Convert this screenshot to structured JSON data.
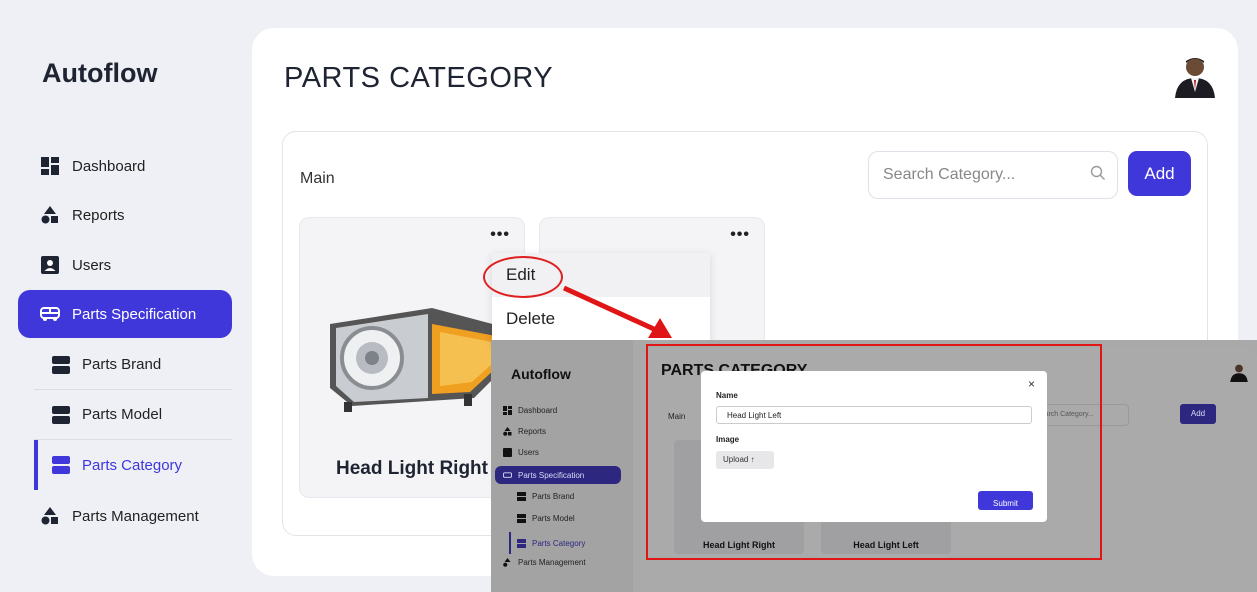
{
  "app": {
    "brand": "Autoflow",
    "page_title": "PARTS CATEGORY"
  },
  "sidebar": {
    "items": [
      {
        "label": "Dashboard",
        "icon": "dashboard-icon"
      },
      {
        "label": "Reports",
        "icon": "reports-icon"
      },
      {
        "label": "Users",
        "icon": "user-icon"
      },
      {
        "label": "Parts Specification",
        "icon": "car-icon",
        "active": true
      },
      {
        "label": "Parts Management",
        "icon": "shapes-icon"
      }
    ],
    "sub_items": [
      {
        "label": "Parts Brand",
        "icon": "layers-icon"
      },
      {
        "label": "Parts Model",
        "icon": "layers-icon"
      },
      {
        "label": "Parts Category",
        "icon": "layers-icon",
        "active": true
      }
    ]
  },
  "panel": {
    "label": "Main",
    "search_placeholder": "Search Category...",
    "add_label": "Add"
  },
  "categories": [
    {
      "name": "Head Light Right",
      "menu": "•••"
    },
    {
      "name": "",
      "menu": "•••"
    }
  ],
  "context_menu": {
    "items": [
      "Edit",
      "Delete"
    ]
  },
  "modal_shot": {
    "brand": "Autoflow",
    "title": "PARTS CATEGORY",
    "nav": [
      "Dashboard",
      "Reports",
      "Users",
      "Parts Specification",
      "Parts Brand",
      "Parts Model",
      "Parts Category",
      "Parts Management"
    ],
    "panel_label": "Main",
    "search_text": "Search Category...",
    "add_label": "Add",
    "categories": [
      "Head Light Right",
      "Head Light Left"
    ],
    "modal": {
      "close": "×",
      "name_label": "Name",
      "name_value": "Head Light Left",
      "image_label": "Image",
      "upload_label": "Upload ↑",
      "submit_label": "Submit"
    }
  },
  "colors": {
    "accent": "#3f37d9",
    "annotation": "#e01515"
  }
}
